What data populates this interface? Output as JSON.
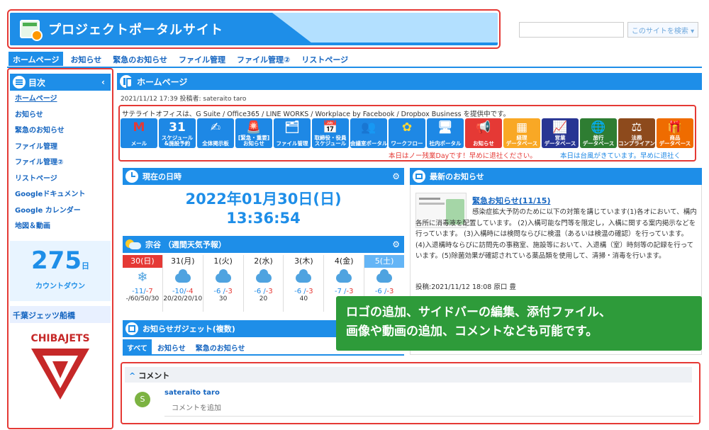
{
  "header": {
    "title": "プロジェクトポータルサイト",
    "search_placeholder": "",
    "search_button": "このサイトを検索 ▾"
  },
  "nav": {
    "tabs": [
      "ホームページ",
      "お知らせ",
      "緊急のお知らせ",
      "ファイル管理",
      "ファイル管理②",
      "リストページ"
    ]
  },
  "sidebar": {
    "title": "目次",
    "collapse": "‹",
    "items": [
      "ホームページ",
      "お知らせ",
      "緊急のお知らせ",
      "ファイル管理",
      "ファイル管理②",
      "リストページ",
      "Googleドキュメント",
      "Google カレンダー",
      "地図＆動画"
    ],
    "countdown": {
      "number": "275",
      "unit": "日",
      "label": "カウントダウン"
    },
    "chiba_title": "千葉ジェッツ船橋",
    "chiba_logo_text": "CHIBAJETS"
  },
  "main": {
    "title": "ホームページ",
    "meta": "2021/11/12 17:39 投稿者: sateraito taro",
    "intro": "サテライトオフィスは、G Suite / Office365 / LINE WORKS / Workplace by Facebook / Dropbox Business を提供中です。",
    "apps": [
      {
        "l1": "",
        "l2": "メール",
        "color": "#1e88e5",
        "glyph": "M",
        "gcolor": "#e53935",
        "name": "gmail-icon"
      },
      {
        "l1": "スケジュール",
        "l2": "&施設予約",
        "color": "#1e88e5",
        "glyph": "31",
        "gcolor": "#fff",
        "name": "calendar-icon"
      },
      {
        "l1": "",
        "l2": "全体掲示板",
        "color": "#1e88e5",
        "glyph": "✍",
        "gcolor": "#fff",
        "name": "board-icon"
      },
      {
        "l1": "[緊急・重要]",
        "l2": "お知らせ",
        "color": "#1e88e5",
        "glyph": "🚨",
        "gcolor": "#fff",
        "name": "alarm-icon"
      },
      {
        "l1": "",
        "l2": "ファイル管理",
        "color": "#1e88e5",
        "glyph": "🗂",
        "gcolor": "#fff",
        "name": "file-icon"
      },
      {
        "l1": "取締役・役員",
        "l2": "スケジュール",
        "color": "#1e88e5",
        "glyph": "📅",
        "gcolor": "#fff",
        "name": "exec-calendar-icon"
      },
      {
        "l1": "",
        "l2": "会議室ポータル",
        "color": "#1e88e5",
        "glyph": "👥",
        "gcolor": "#fff",
        "name": "meeting-icon"
      },
      {
        "l1": "",
        "l2": "ワークフロー",
        "color": "#1e88e5",
        "glyph": "✿",
        "gcolor": "#fdd835",
        "name": "workflow-icon"
      },
      {
        "l1": "",
        "l2": "社内ポータル",
        "color": "#1e88e5",
        "glyph": "🖥",
        "gcolor": "#fff",
        "name": "portal-icon"
      },
      {
        "l1": "",
        "l2": "お知らせ",
        "color": "#e53935",
        "glyph": "📢",
        "gcolor": "#fff",
        "name": "megaphone-icon"
      },
      {
        "l1": "経理",
        "l2": "データベース",
        "color": "#f9a825",
        "glyph": "▦",
        "gcolor": "#fff",
        "name": "accounting-icon"
      },
      {
        "l1": "営業",
        "l2": "データベース",
        "color": "#283593",
        "glyph": "📈",
        "gcolor": "#fff",
        "name": "sales-icon"
      },
      {
        "l1": "旅行",
        "l2": "データベース",
        "color": "#2e7d32",
        "glyph": "🌐",
        "gcolor": "#fff",
        "name": "travel-icon"
      },
      {
        "l1": "法務",
        "l2": "コンプライアンス",
        "color": "#8d4a1c",
        "glyph": "⚖",
        "gcolor": "#fff",
        "name": "legal-icon"
      },
      {
        "l1": "商品",
        "l2": "データベース",
        "color": "#ef6c00",
        "glyph": "🎁",
        "gcolor": "#fff",
        "name": "product-icon"
      }
    ],
    "alert_red": "本日はノー残業Dayです！早めに退社ください。",
    "alert_blue": "本日は台風がきています。早めに退社く"
  },
  "datetime": {
    "title": "現在の日時",
    "date": "2022年01月30日(日)",
    "time": "13:36:54"
  },
  "weather": {
    "title": "宗谷 （週間天気予報）",
    "days": [
      {
        "day": "30(日)",
        "icon": "snow",
        "lo": "-11/",
        "hi": "-7",
        "rain": "-/60/50/30",
        "kind": "sun"
      },
      {
        "day": "31(月)",
        "icon": "cloud",
        "lo": "-10/",
        "hi": "-4",
        "rain": "20/20/20/10",
        "kind": ""
      },
      {
        "day": "1(火)",
        "icon": "cloud",
        "lo": "-6 /",
        "hi": "-3",
        "rain": "30",
        "kind": ""
      },
      {
        "day": "2(水)",
        "icon": "cloud",
        "lo": "-6 /",
        "hi": "-3",
        "rain": "20",
        "kind": ""
      },
      {
        "day": "3(木)",
        "icon": "cloud",
        "lo": "-6 /",
        "hi": "-3",
        "rain": "40",
        "kind": ""
      },
      {
        "day": "4(金)",
        "icon": "cloud",
        "lo": "-7 /",
        "hi": "-3",
        "rain": "",
        "kind": ""
      },
      {
        "day": "5(土)",
        "icon": "cloud",
        "lo": "-6 /",
        "hi": "-3",
        "rain": "",
        "kind": "sat"
      }
    ]
  },
  "gadget": {
    "title": "お知らせガジェット(複数)",
    "tabs": [
      "すべて",
      "お知らせ",
      "緊急のお知らせ"
    ]
  },
  "news": {
    "title": "最新のお知らせ",
    "item_title": "緊急お知らせ(11/15)",
    "body": "感染症拡大予防のために以下の対策を講じています(1)各オにおいて、構内各所に消毒液を配置しています。 (2)入構可能な門等を限定し，入構に関する案内掲示などを行っています。 (3)入構時には検問ならびに検温（あるいは検温の確認）を行っています。 (4)入退構時ならびに訪問先の事務室、施設等において、入退構（室）時刻等の記録を行っています。(5)除菌効果が確認されている薬品類を使用して、清掃・消毒を行います。",
    "posted": "投稿:2021/11/12 18:08 原口 豊"
  },
  "callout": {
    "line1": "ロゴの追加、サイドバーの編集、添付ファイル、",
    "line2": "画像や動画の追加、コメントなども可能です。"
  },
  "comment": {
    "title": "コメント",
    "user": "sateraito taro",
    "avatar": "S",
    "placeholder": "コメントを追加"
  },
  "colors": {
    "primary": "#1e8ee8",
    "highlight_border": "#e53935",
    "callout": "#2e9b3a"
  }
}
